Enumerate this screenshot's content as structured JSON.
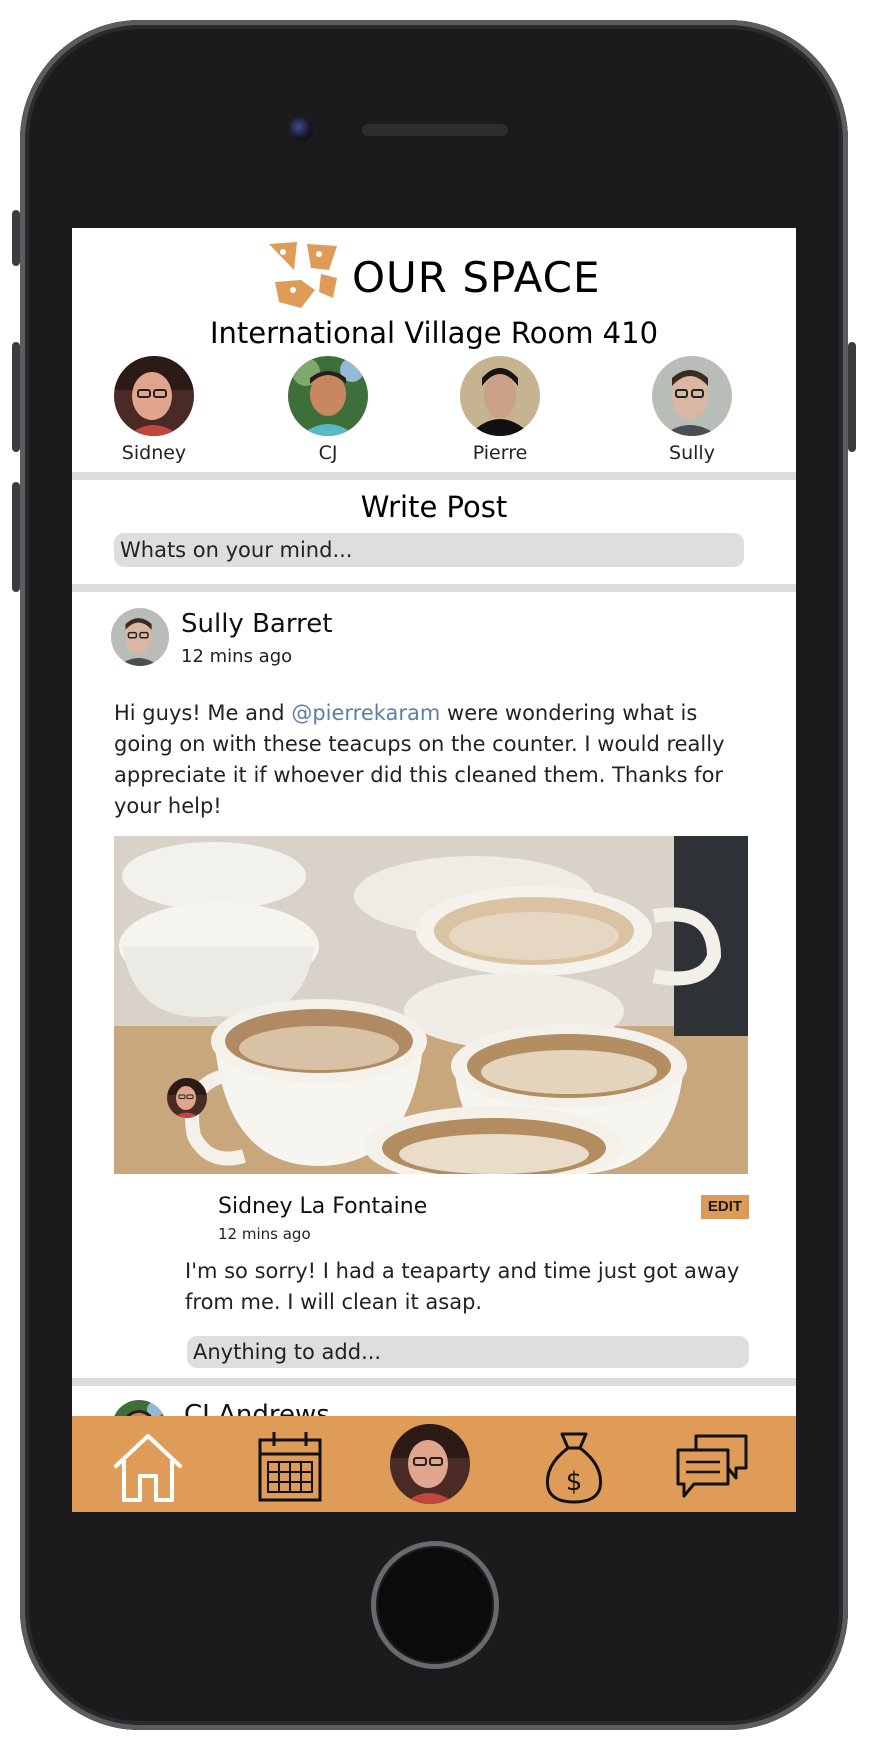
{
  "app": {
    "name": "OUR SPACE",
    "room": "International Village Room 410"
  },
  "roommates": [
    {
      "name": "Sidney"
    },
    {
      "name": "CJ"
    },
    {
      "name": "Pierre"
    },
    {
      "name": "Sully"
    }
  ],
  "composer": {
    "title": "Write Post",
    "placeholder": "Whats on your mind..."
  },
  "post": {
    "author": "Sully Barret",
    "time": "12 mins ago",
    "text_before": "Hi guys! Me and ",
    "mention": "@pierrekaram",
    "text_after": " were wondering what is going on with these teacups on the counter. I would really appreciate it if whoever did this cleaned them. Thanks for your help!"
  },
  "reply": {
    "author": "Sidney La Fontaine",
    "time": "12 mins ago",
    "edit_label": "EDIT",
    "text": "I'm so sorry! I had a teaparty and time just got away from me. I will clean it asap.",
    "add_placeholder": "Anything to add..."
  },
  "next_post": {
    "author": "CJ Andrews"
  },
  "tabs": [
    {
      "icon": "home-icon"
    },
    {
      "icon": "calendar-icon"
    },
    {
      "icon": "profile-avatar"
    },
    {
      "icon": "money-bag-icon"
    },
    {
      "icon": "chat-icon"
    }
  ],
  "colors": {
    "accent": "#df9b58",
    "divider": "#dcdcdc",
    "input_bg": "#dedede",
    "mention": "#5d7fa6"
  }
}
